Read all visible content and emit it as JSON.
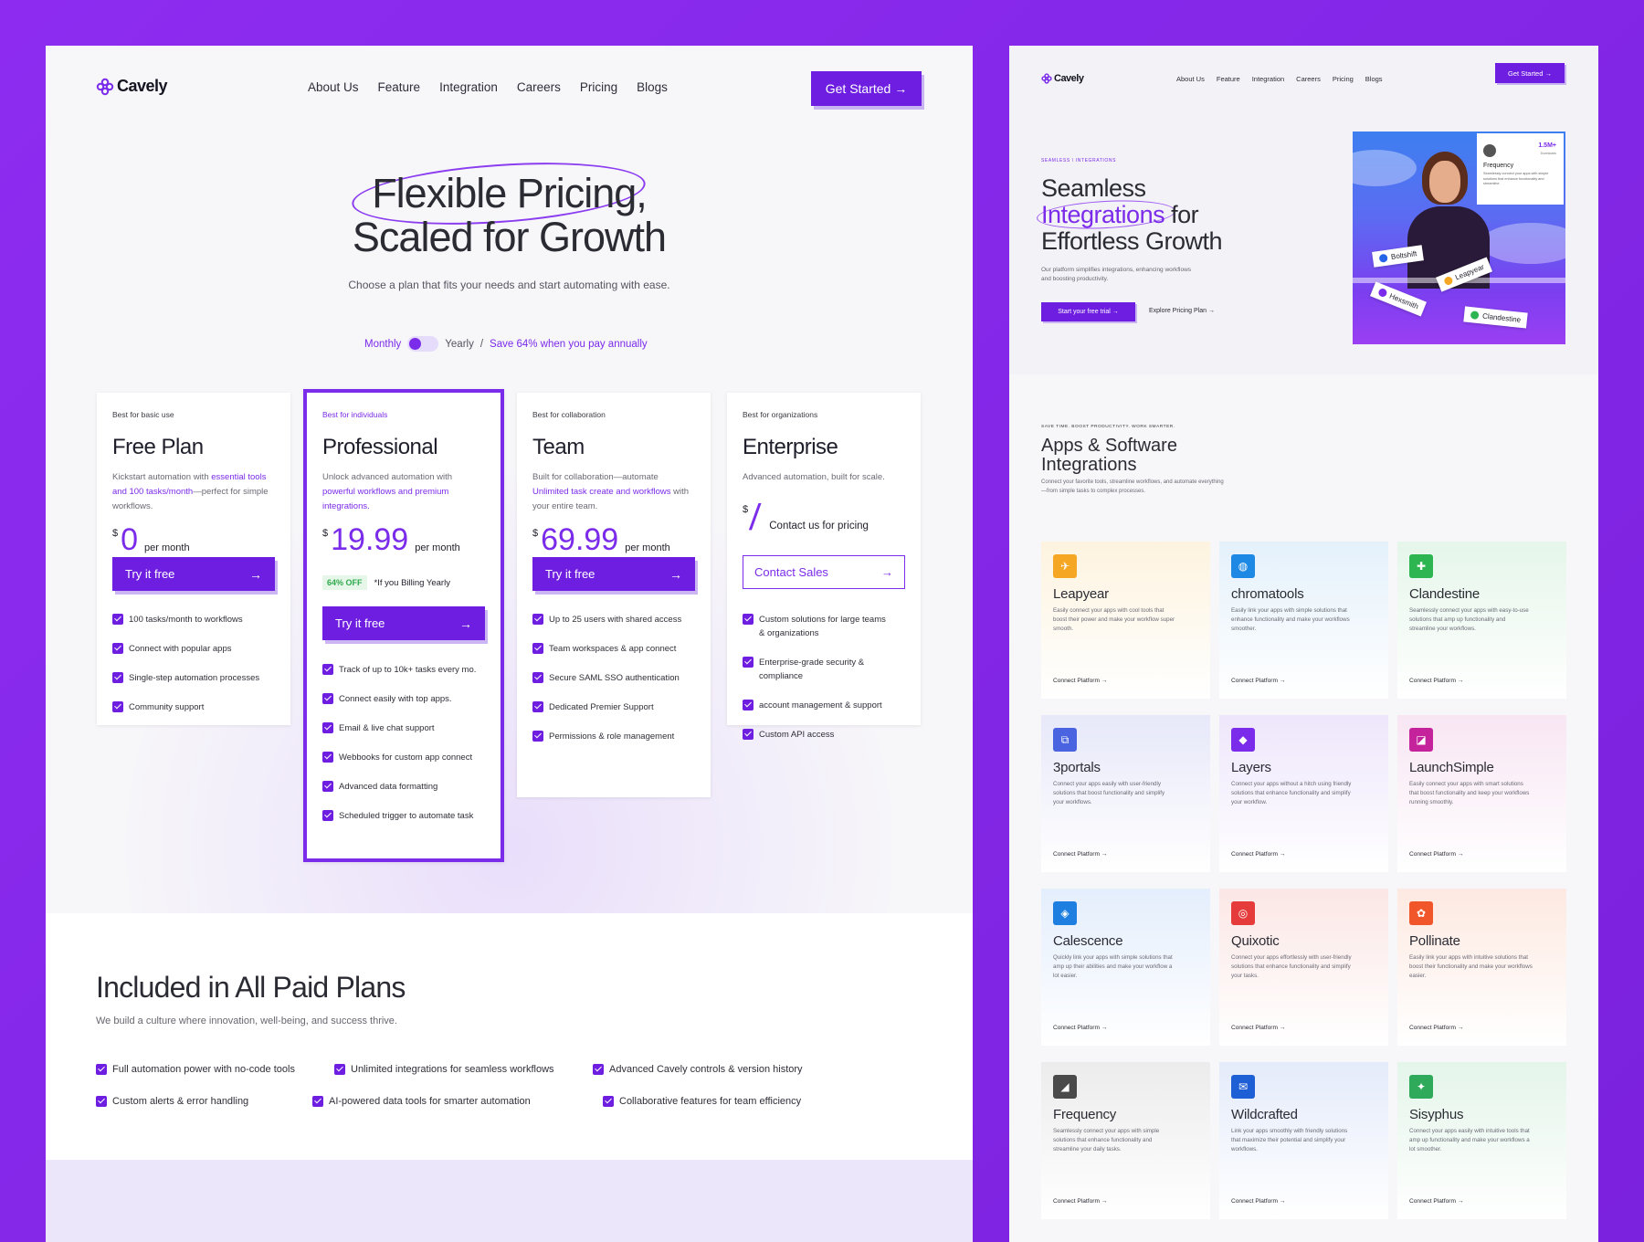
{
  "brand": {
    "name": "Cavely",
    "accent": "#6d1ee0",
    "background": "#8a2be2"
  },
  "left": {
    "nav": {
      "links": [
        "About Us",
        "Feature",
        "Integration",
        "Careers",
        "Pricing",
        "Blogs"
      ],
      "cta": "Get Started →"
    },
    "hero": {
      "title_line1": "Flexible Pricing,",
      "title_line2": "Scaled for Growth",
      "subtitle": "Choose a plan that fits your needs and start automating with ease."
    },
    "billing": {
      "monthly": "Monthly",
      "yearly": "Yearly",
      "separator": "/",
      "save": "Save 64% when you pay annually"
    },
    "plans": [
      {
        "tag": "Best for basic use",
        "name": "Free Plan",
        "desc_1": "Kickstart automation with ",
        "desc_hl": "essential tools and 100 tasks/month",
        "desc_2": "—perfect for simple workflows.",
        "currency": "$",
        "price": "0",
        "per": "per month",
        "cta": "Try it free",
        "features": [
          "100 tasks/month to workflows",
          "Connect with popular apps",
          "Single-step automation processes",
          "Community support"
        ]
      },
      {
        "tag": "Best for individuals",
        "name": "Professional",
        "desc_1": "Unlock advanced automation with ",
        "desc_hl": "powerful workflows and premium integrations.",
        "desc_2": "",
        "currency": "$",
        "price": "19.99",
        "per": "per month",
        "off": "64% OFF",
        "off_note": "*If you Billing Yearly",
        "cta": "Try it free",
        "features": [
          "Track of up to 10k+ tasks every mo.",
          "Connect easily with top apps.",
          "Email & live chat support",
          "Webbooks for custom app connect",
          "Advanced data formatting",
          "Scheduled trigger to automate task"
        ]
      },
      {
        "tag": "Best for collaboration",
        "name": "Team",
        "desc_1": "Built for collaboration—automate ",
        "desc_hl": "Unlimited task create and workflows",
        "desc_2": " with your entire team.",
        "currency": "$",
        "price": "69.99",
        "per": "per month",
        "cta": "Try it free",
        "features": [
          "Up to 25 users with shared access",
          "Team workspaces & app connect",
          "Secure SAML SSO authentication",
          "Dedicated Premier Support",
          "Permissions & role management"
        ]
      },
      {
        "tag": "Best for organizations",
        "name": "Enterprise",
        "desc_1": "Advanced automation, built for scale.",
        "desc_hl": "",
        "desc_2": "",
        "currency": "$",
        "price_text": "Contact us for pricing",
        "cta": "Contact Sales",
        "features": [
          "Custom solutions for large teams & organizations",
          "Enterprise-grade security & compliance",
          "account management & support",
          "Custom API access"
        ]
      }
    ],
    "included": {
      "title": "Included in All Paid Plans",
      "subtitle": "We build a culture where innovation, well-being, and success thrive.",
      "items": [
        "Full automation power with no-code tools",
        "Unlimited integrations for seamless workflows",
        "Advanced Cavely controls & version history",
        "Custom alerts & error handling",
        "AI-powered data tools for smarter automation",
        "Collaborative features for team efficiency"
      ]
    }
  },
  "right": {
    "nav": {
      "links": [
        "About Us",
        "Feature",
        "Integration",
        "Careers",
        "Pricing",
        "Blogs"
      ],
      "cta": "Get Started →"
    },
    "hero": {
      "kicker": "SEAMLESS \\ INTEGRATIONS",
      "title_1": "Seamless",
      "title_hl": "Integrations",
      "title_2": " for",
      "title_3": "Effortless Growth",
      "desc": "Our platform simplifies integrations, enhancing workflows and boosting productivity.",
      "cta_primary": "Start your free trial →",
      "cta_secondary": "Explore Pricing Plan →"
    },
    "photo_card": {
      "stat": "1.5M+",
      "stat_label": "Downloads",
      "title": "Frequency",
      "desc": "Seamlessly connect your apps with simple solutions that enhance functionality and streamline."
    },
    "chips": [
      "Boltshift",
      "Leapyear",
      "Hexsmith",
      "Clandestine"
    ],
    "apps": {
      "kicker": "SAVE TIME. BOOST PRODUCTIVITY. WORK SMARTER.",
      "title_1": "Apps & Software",
      "title_2": "Integrations",
      "desc": "Connect your favorite tools, streamline workflows, and automate everything—from simple tasks to complex processes.",
      "link": "Connect Platform →",
      "cards": [
        {
          "name": "Leapyear",
          "desc": "Easily connect your apps with cool tools that boost their power and make your workflow super smooth.",
          "icon": "leapyear-icon",
          "color": "#f5a623",
          "bg": "#fdf3df"
        },
        {
          "name": "chromatools",
          "desc": "Easily link your apps with simple solutions that enhance functionality and make your workflows smoother.",
          "icon": "chromatools-icon",
          "color": "#1e88e5",
          "bg": "#e4f1fb"
        },
        {
          "name": "Clandestine",
          "desc": "Seamlessly connect your apps with easy-to-use solutions that amp up functionality and streamline your workflows.",
          "icon": "clandestine-icon",
          "color": "#2db552",
          "bg": "#e5f6ea"
        },
        {
          "name": "3portals",
          "desc": "Connect your apps easily with user-friendly solutions that boost functionality and simplify your workflows.",
          "icon": "3portals-icon",
          "color": "#4a63e0",
          "bg": "#e7e8f9"
        },
        {
          "name": "Layers",
          "desc": "Connect your apps without a hitch using friendly solutions that enhance functionality and simplify your workflow.",
          "icon": "layers-icon",
          "color": "#7b2bea",
          "bg": "#eee6fb"
        },
        {
          "name": "LaunchSimple",
          "desc": "Easily connect your apps with smart solutions that boost functionality and keep your workflows running smoothly.",
          "icon": "launchsimple-icon",
          "color": "#c4239b",
          "bg": "#f8e6f3"
        },
        {
          "name": "Calescence",
          "desc": "Quickly link your apps with simple solutions that amp up their abilities and make your workflow a lot easier.",
          "icon": "calescence-icon",
          "color": "#1e7fe0",
          "bg": "#e4eefc"
        },
        {
          "name": "Quixotic",
          "desc": "Connect your apps effortlessly with user-friendly solutions that enhance functionality and simplify your tasks.",
          "icon": "quixotic-icon",
          "color": "#e53b3b",
          "bg": "#fbe7e5"
        },
        {
          "name": "Pollinate",
          "desc": "Easily link your apps with intuitive solutions that boost their functionality and make your workflows easier.",
          "icon": "pollinate-icon",
          "color": "#f0562a",
          "bg": "#fde9e1"
        },
        {
          "name": "Frequency",
          "desc": "Seamlessly connect your apps with simple solutions that enhance functionality and streamline your daily tasks.",
          "icon": "frequency-icon",
          "color": "#4a4a4a",
          "bg": "#ececec"
        },
        {
          "name": "Wildcrafted",
          "desc": "Link your apps smoothly with friendly solutions that maximize their potential and simplify your workflows.",
          "icon": "wildcrafted-icon",
          "color": "#1f5fd6",
          "bg": "#e4ebfa"
        },
        {
          "name": "Sisyphus",
          "desc": "Connect your apps easily with intuitive tools that amp up functionality and make your workflows a lot smoother.",
          "icon": "sisyphus-icon",
          "color": "#2eaa5a",
          "bg": "#e4f5ea"
        }
      ]
    }
  }
}
